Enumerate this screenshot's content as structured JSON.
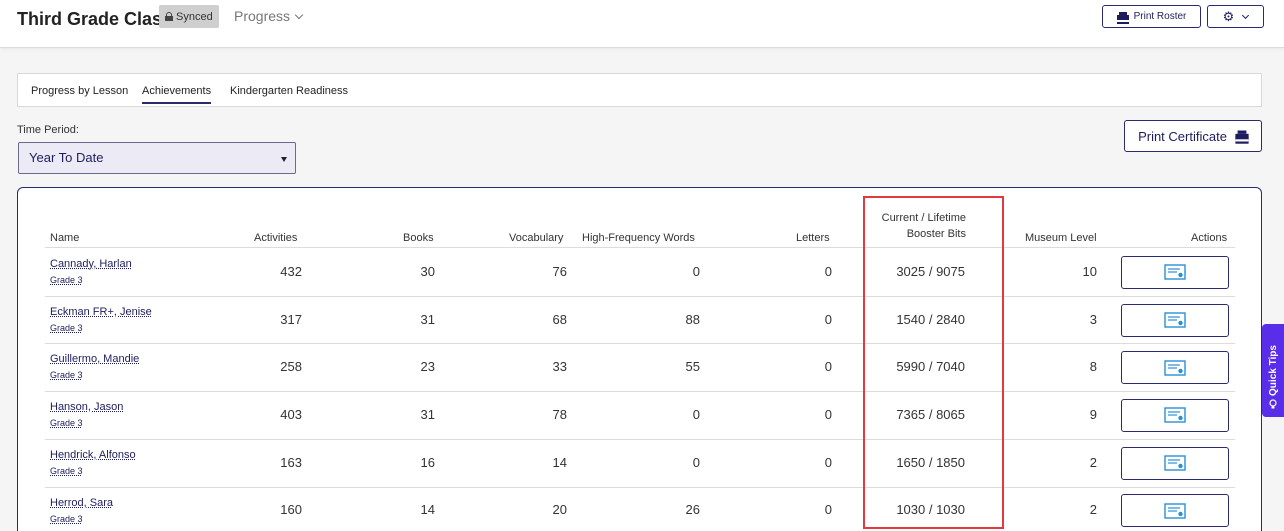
{
  "header": {
    "class_title": "Third Grade Class",
    "synced_label": "Synced",
    "progress_label": "Progress",
    "print_roster_label": "Print Roster"
  },
  "tabs": [
    {
      "label": "Progress by Lesson",
      "active": false
    },
    {
      "label": "Achievements",
      "active": true
    },
    {
      "label": "Kindergarten Readiness",
      "active": false
    }
  ],
  "filters": {
    "time_period_label": "Time Period:",
    "time_period_value": "Year To Date"
  },
  "print_certificate_label": "Print Certificate",
  "table": {
    "columns": {
      "name": "Name",
      "activities": "Activities",
      "books": "Books",
      "vocabulary": "Vocabulary",
      "hfw": "High-Frequency Words",
      "letters": "Letters",
      "booster_line1": "Current / Lifetime",
      "booster_line2": "Booster Bits",
      "museum": "Museum Level",
      "actions": "Actions"
    },
    "rows": [
      {
        "name": "Cannady, Harlan",
        "grade": "Grade 3",
        "activities": "432",
        "books": "30",
        "vocabulary": "76",
        "hfw": "0",
        "letters": "0",
        "booster": "3025 / 9075",
        "museum": "10"
      },
      {
        "name": "Eckman FR+, Jenise",
        "grade": "Grade 3",
        "activities": "317",
        "books": "31",
        "vocabulary": "68",
        "hfw": "88",
        "letters": "0",
        "booster": "1540 / 2840",
        "museum": "3"
      },
      {
        "name": "Guillermo, Mandie",
        "grade": "Grade 3",
        "activities": "258",
        "books": "23",
        "vocabulary": "33",
        "hfw": "55",
        "letters": "0",
        "booster": "5990 / 7040",
        "museum": "8"
      },
      {
        "name": "Hanson, Jason",
        "grade": "Grade 3",
        "activities": "403",
        "books": "31",
        "vocabulary": "78",
        "hfw": "0",
        "letters": "0",
        "booster": "7365 / 8065",
        "museum": "9"
      },
      {
        "name": "Hendrick, Alfonso",
        "grade": "Grade 3",
        "activities": "163",
        "books": "16",
        "vocabulary": "14",
        "hfw": "0",
        "letters": "0",
        "booster": "1650 / 1850",
        "museum": "2"
      },
      {
        "name": "Herrod, Sara",
        "grade": "Grade 3",
        "activities": "160",
        "books": "14",
        "vocabulary": "20",
        "hfw": "26",
        "letters": "0",
        "booster": "1030 / 1030",
        "museum": "2"
      }
    ]
  },
  "quick_tips_label": "Quick Tips",
  "colors": {
    "brand_navy": "#1d1d5e",
    "highlight_red": "#e0393e",
    "quick_tips_purple": "#5a2ee8",
    "certificate_icon_blue": "#2b8fd6"
  }
}
